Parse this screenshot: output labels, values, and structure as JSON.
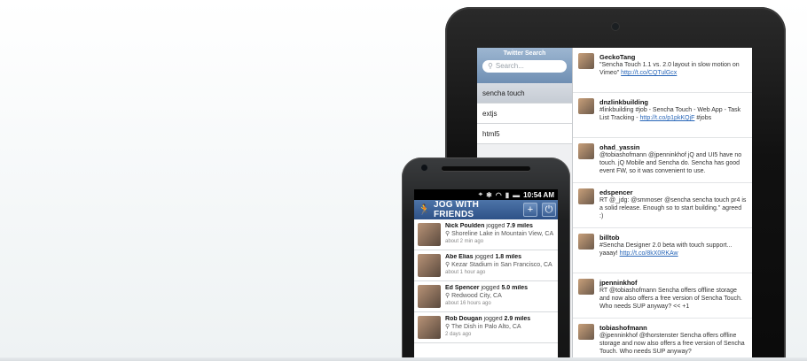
{
  "tablet": {
    "sidebar": {
      "title": "Twitter Search",
      "search_placeholder": "Search...",
      "items": [
        {
          "label": "sencha touch",
          "active": true
        },
        {
          "label": "extjs",
          "active": false
        },
        {
          "label": "html5",
          "active": false
        }
      ]
    },
    "tweets": [
      {
        "user": "GeckoTang",
        "text": "\"Sencha Touch 1.1 vs. 2.0 layout in slow motion on Vimeo\"",
        "link": "http://t.co/CQTulGcx"
      },
      {
        "user": "dnzlinkbuilding",
        "text": "#linkbuilding #job - Sencha Touch - Web App - Task List Tracking -",
        "link": "http://t.co/p1pkKQjF",
        "tail": "#jobs"
      },
      {
        "user": "ohad_yassin",
        "text": "@tobiashofmann @jpenninkhof jQ and UI5 have no touch. jQ Mobile and Sencha do. Sencha has good event FW, so it was convenient to use.",
        "link": "",
        "tail": ""
      },
      {
        "user": "edspencer",
        "text": "RT @_jdg: @smmoser @sencha sencha touch pr4 is a solid release. Enough so to start building.\" agreed :)",
        "link": "",
        "tail": ""
      },
      {
        "user": "billtob",
        "text": "#Sencha Designer 2.0 beta with touch support... yaaay!",
        "link": "http://t.co/8kX0RKAw",
        "tail": ""
      },
      {
        "user": "jpenninkhof",
        "text": "RT @tobiashofmann Sencha offers offline storage and now also offers a free version of Sencha Touch. Who needs SUP anyway? << +1",
        "link": "",
        "tail": ""
      },
      {
        "user": "tobiashofmann",
        "text": "@jpenninkhof @thorstenster Sencha offers offline storage and now also offers a free version of Sencha Touch. Who needs SUP anyway?",
        "link": "",
        "tail": ""
      }
    ]
  },
  "phone": {
    "status": {
      "time": "10:54 AM"
    },
    "app": {
      "title": "JOG WITH FRIENDS",
      "add_icon": "+",
      "power_icon": "⏻"
    },
    "jogged_word": "jogged",
    "runs": [
      {
        "name": "Nick Poulden",
        "miles": "7.9 miles",
        "location": "Shoreline Lake in Mountain View, CA",
        "ago": "about 2 min ago"
      },
      {
        "name": "Abe Elias",
        "miles": "1.8 miles",
        "location": "Kezar Stadium in San Francisco, CA",
        "ago": "about 1 hour ago"
      },
      {
        "name": "Ed Spencer",
        "miles": "5.0 miles",
        "location": "Redwood City, CA",
        "ago": "about 16 hours ago"
      },
      {
        "name": "Rob Dougan",
        "miles": "2.9 miles",
        "location": "The Dish in Palo Alto, CA",
        "ago": "2 days ago"
      }
    ]
  }
}
